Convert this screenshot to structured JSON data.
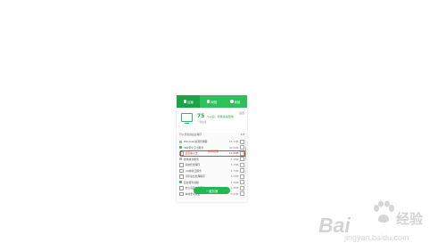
{
  "tabs": [
    {
      "label": "加速",
      "icon": "rocket-icon"
    },
    {
      "label": "网络",
      "icon": "globe-icon"
    },
    {
      "label": "系统",
      "icon": "home-icon"
    }
  ],
  "status": {
    "percent": "75",
    "message": "%以后，我能提速更快",
    "sub": "一键加速",
    "settings": "设置"
  },
  "list": {
    "header": "可以优化的后台程序",
    "count": "1/8"
  },
  "rows": [
    {
      "name": "Windows资源管理器",
      "size": "55.1MB",
      "icon": "app-icon"
    },
    {
      "name": "360安全卫士服务",
      "size": "49.5MB",
      "icon": "shield-icon"
    },
    {
      "name": "百度输入法",
      "size": "12.6MB",
      "icon": "app-icon",
      "tag": "推荐结束"
    },
    {
      "name": "搜狗拼音服务",
      "size": "5.4MB",
      "icon": "app-icon"
    },
    {
      "name": "系统托盘程序",
      "size": "3.7MB",
      "icon": "app-icon"
    },
    {
      "name": "QQ拼音云服务",
      "size": "2.7MB",
      "icon": "app-icon"
    },
    {
      "name": "打印后台处理程序",
      "size": "2.0MB",
      "icon": "app-icon"
    },
    {
      "name": "后台服务进程",
      "size": "1.4MB",
      "icon": "green-dot-icon"
    },
    {
      "name": "金山毒霸主防服务",
      "size": "1.4MB",
      "icon": "app-icon"
    },
    {
      "name": "本地安全认证",
      "size": "0.9MB",
      "icon": "app-icon"
    }
  ],
  "action": {
    "label": "一键加速"
  },
  "watermark": {
    "brand": "Bai",
    "brand_cn": "经验",
    "url": "jingyan.baidu.com"
  }
}
